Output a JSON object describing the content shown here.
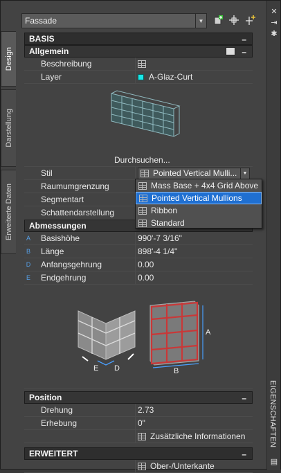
{
  "header": {
    "style_combo": "Fassade"
  },
  "left_tabs": [
    {
      "label": "Design",
      "active": true
    },
    {
      "label": "Darstellung",
      "active": false
    },
    {
      "label": "Erweiterte Daten",
      "active": false
    }
  ],
  "right_strip": {
    "title": "EIGENSCHAFTEN"
  },
  "basis": {
    "title": "BASIS",
    "allgemein": {
      "title": "Allgemein",
      "rows": {
        "beschreibung": {
          "name": "Beschreibung",
          "value": ""
        },
        "layer": {
          "name": "Layer",
          "value": "A-Glaz-Curt",
          "color": "#19e6e6"
        }
      },
      "browse_label": "Durchsuchen...",
      "stil": {
        "name": "Stil",
        "value": "Pointed Vertical Mulli..."
      },
      "raum": {
        "name": "Raumumgrenzung"
      },
      "segment": {
        "name": "Segmentart"
      },
      "schatten": {
        "name": "Schattendarstellung"
      }
    },
    "abmessungen": {
      "title": "Abmessungen",
      "rows": [
        {
          "marker": "A",
          "name": "Basishöhe",
          "value": "990'-7 3/16\""
        },
        {
          "marker": "B",
          "name": "Länge",
          "value": "898'-4 1/4\""
        },
        {
          "marker": "D",
          "name": "Anfangsgehrung",
          "value": "0.00"
        },
        {
          "marker": "E",
          "name": "Endgehrung",
          "value": "0.00"
        }
      ]
    }
  },
  "position": {
    "title": "Position",
    "drehung": {
      "name": "Drehung",
      "value": "2.73"
    },
    "erhebung": {
      "name": "Erhebung",
      "value": "0\""
    },
    "extra_info": "Zusätzliche Informationen"
  },
  "erweitert": {
    "title": "ERWEITERT",
    "ober_unter": "Ober-/Unterkante"
  },
  "style_dropdown": {
    "options": [
      "Mass Base + 4x4 Grid Above",
      "Pointed Vertical Mullions",
      "Ribbon",
      "Standard"
    ],
    "selected": "Pointed Vertical Mullions"
  },
  "diagram_labels": {
    "a": "A",
    "b": "B",
    "d": "D",
    "e": "E"
  },
  "colors": {
    "selection": "#1f6fd1",
    "dimension_marker": "#56a0e8",
    "layer_swatch": "#19e6e6"
  }
}
